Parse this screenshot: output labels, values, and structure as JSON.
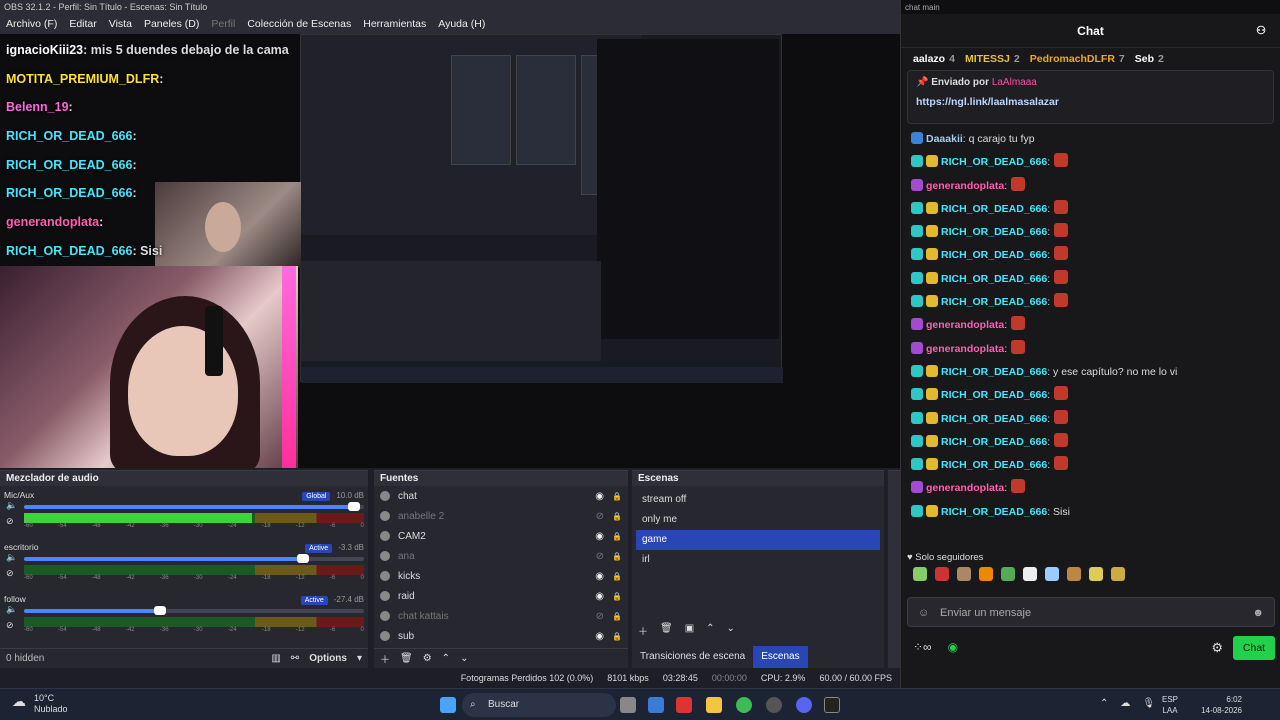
{
  "titlebar": {
    "text": "OBS 32.1.2 - Perfil: Sin Título - Escenas: Sin Título"
  },
  "menu": {
    "items": [
      "Archivo (F)",
      "Editar",
      "Vista",
      "Paneles (D)",
      "Perfil",
      "Colección de Escenas",
      "Herramientas",
      "Ayuda (H)"
    ]
  },
  "overlay_chat": [
    {
      "user": "ignacioKiii23",
      "text": ": mis 5 duendes debajo de la cama",
      "color": "#ffffff"
    },
    {
      "user": "MOTITA_PREMIUM_DLFR",
      "text": ":",
      "color": "#ffe033"
    },
    {
      "user": "Belenn_19",
      "text": ":",
      "color": "#ff66e0"
    },
    {
      "user": "RICH_OR_DEAD_666",
      "text": ":",
      "color": "#44e7ff"
    },
    {
      "user": "RICH_OR_DEAD_666",
      "text": ":",
      "color": "#44e7ff"
    },
    {
      "user": "RICH_OR_DEAD_666",
      "text": ":",
      "color": "#44e7ff"
    },
    {
      "user": "generandoplata",
      "text": ":",
      "color": "#ff5fb0"
    },
    {
      "user": "RICH_OR_DEAD_666",
      "text": ": Sisi",
      "color": "#44e7ff"
    }
  ],
  "mixer": {
    "title": "Mezclador de audio",
    "channels": [
      {
        "name": "Mic/Aux",
        "badge": "Global",
        "db": "10.0 dB",
        "volume": 0.97,
        "level": 0.67
      },
      {
        "name": "escritorio",
        "badge": "Active",
        "db": "-3.3 dB",
        "volume": 0.82,
        "level": 0.0
      },
      {
        "name": "follow",
        "badge": "Active",
        "db": "-27.4 dB",
        "volume": 0.4,
        "level": 0.0
      }
    ],
    "scale": [
      "-60",
      "-54",
      "-48",
      "-42",
      "-36",
      "-30",
      "-24",
      "-18",
      "-12",
      "-6",
      "0"
    ],
    "hidden": "0 hidden",
    "options": "Options"
  },
  "sources": {
    "title": "Fuentes",
    "items": [
      {
        "name": "chat",
        "visible": true
      },
      {
        "name": "anabelle 2",
        "visible": false
      },
      {
        "name": "CAM2",
        "visible": true
      },
      {
        "name": "ana",
        "visible": false
      },
      {
        "name": "kicks",
        "visible": true
      },
      {
        "name": "raid",
        "visible": true
      },
      {
        "name": "chat kattais",
        "visible": false
      },
      {
        "name": "sub",
        "visible": true
      }
    ]
  },
  "scenes": {
    "title": "Escenas",
    "items": [
      "stream off",
      "only me",
      "game",
      "irl"
    ],
    "selected": "game",
    "tab_transitions": "Transiciones de escena",
    "tab_scenes": "Escenas"
  },
  "status": {
    "dropped": "Fotogramas Perdidos 102 (0.0%)",
    "bitrate": "8101 kbps",
    "stream_time": "03:28:45",
    "rec_time": "00:00:00",
    "cpu": "CPU: 2.9%",
    "fps": "60.00 / 60.00 FPS"
  },
  "chat": {
    "window_title": "chat main",
    "header": "Chat",
    "gifters": [
      {
        "name": "aalazo",
        "count": "4"
      },
      {
        "name": "MITESSJ",
        "count": "2"
      },
      {
        "name": "PedromachDLFR",
        "count": "7"
      },
      {
        "name": "Seb",
        "count": "2"
      }
    ],
    "pinned_by_label": "Enviado por",
    "pinned_by_user": "LaAlmaaa",
    "pinned_link": "https://ngl.link/laalmasalazar",
    "messages": [
      {
        "user": "Daaakii",
        "text": ": q carajo tu fyp",
        "color": "#a9c8ff"
      },
      {
        "user": "RICH_OR_DEAD_666",
        "text": ":",
        "color": "#44e7ff"
      },
      {
        "user": "generandoplata",
        "text": ":",
        "color": "#ff5fb0"
      },
      {
        "user": "RICH_OR_DEAD_666",
        "text": ":",
        "color": "#44e7ff"
      },
      {
        "user": "RICH_OR_DEAD_666",
        "text": ":",
        "color": "#44e7ff"
      },
      {
        "user": "RICH_OR_DEAD_666",
        "text": ":",
        "color": "#44e7ff"
      },
      {
        "user": "RICH_OR_DEAD_666",
        "text": ":",
        "color": "#44e7ff"
      },
      {
        "user": "RICH_OR_DEAD_666",
        "text": ":",
        "color": "#44e7ff"
      },
      {
        "user": "generandoplata",
        "text": ":",
        "color": "#ff5fb0"
      },
      {
        "user": "generandoplata",
        "text": ":",
        "color": "#ff5fb0"
      },
      {
        "user": "RICH_OR_DEAD_666",
        "text": ": y ese capítulo? no me lo vi",
        "color": "#44e7ff"
      },
      {
        "user": "RICH_OR_DEAD_666",
        "text": ":",
        "color": "#44e7ff"
      },
      {
        "user": "RICH_OR_DEAD_666",
        "text": ":",
        "color": "#44e7ff"
      },
      {
        "user": "RICH_OR_DEAD_666",
        "text": ":",
        "color": "#44e7ff"
      },
      {
        "user": "RICH_OR_DEAD_666",
        "text": ":",
        "color": "#44e7ff"
      },
      {
        "user": "generandoplata",
        "text": ":",
        "color": "#ff5fb0"
      },
      {
        "user": "RICH_OR_DEAD_666",
        "text": ": Sisi",
        "color": "#44e7ff"
      }
    ],
    "followers_only": "Solo seguidores",
    "input_placeholder": "Enviar un mensaje",
    "send_label": "Chat"
  },
  "taskbar": {
    "weather_temp": "10°C",
    "weather_desc": "Nublado",
    "search": "Buscar",
    "lang": "ESP",
    "lang2": "LAA",
    "time": "6:02",
    "date": "14-08-2026"
  }
}
